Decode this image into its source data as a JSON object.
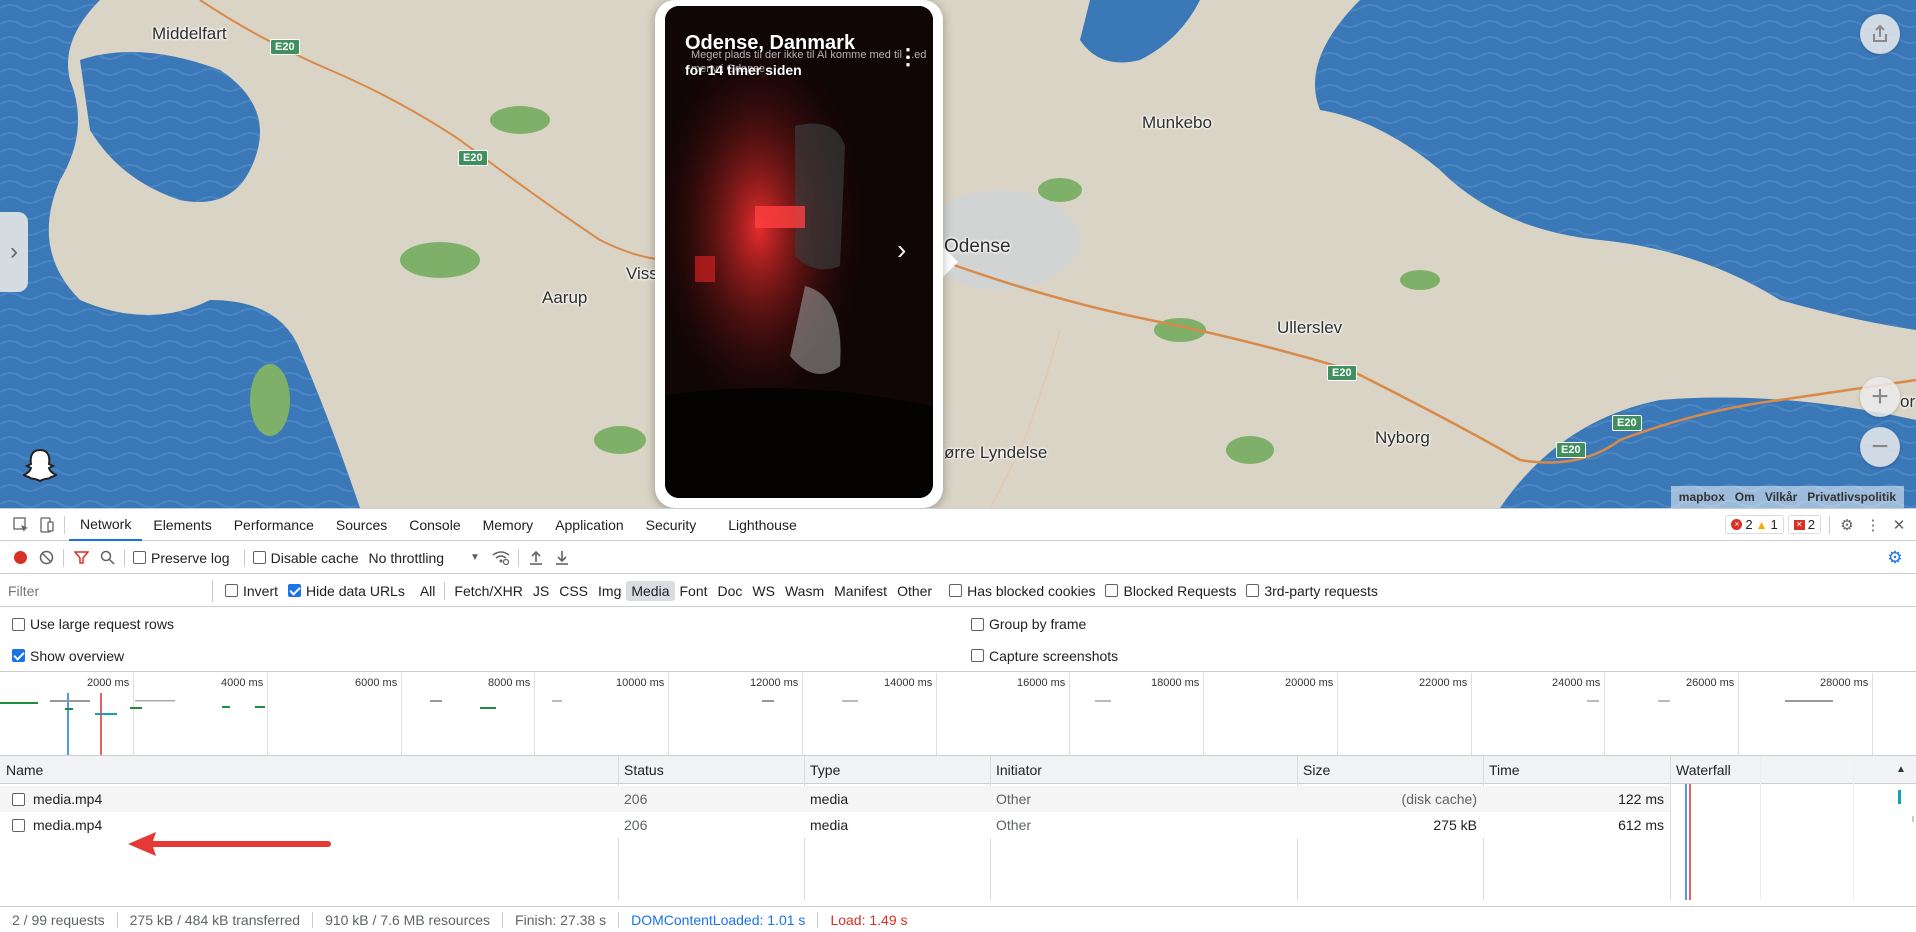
{
  "map": {
    "towns": [
      {
        "name": "Middelfart"
      },
      {
        "name": "Munkebo"
      },
      {
        "name": "Odense"
      },
      {
        "name": "Aarup"
      },
      {
        "name": "Viss"
      },
      {
        "name": "Ullerslev"
      },
      {
        "name": "Nyborg"
      },
      {
        "name": "ørre Lyndelse"
      },
      {
        "name": "or"
      }
    ],
    "road_label": "E20",
    "zoom_in": "+",
    "zoom_out": "−",
    "attribution": {
      "logo": "mapbox",
      "about": "Om",
      "terms": "Vilkår",
      "privacy": "Privatlivspolitik"
    },
    "colors": {
      "water": "#3a78b8",
      "land": "#d9d4c5",
      "park": "#7fb069",
      "road": "#d98a4a"
    }
  },
  "story": {
    "title": "Odense, Danmark",
    "time": "for 14 timer siden",
    "caption": "Meget plads til der ikke til AI komme med til ...ed meny i Odense",
    "menu_icon": "vertical-dots-icon"
  },
  "devtools": {
    "tabs": [
      "Network",
      "Elements",
      "Performance",
      "Sources",
      "Console",
      "Memory",
      "Application",
      "Security",
      "Lighthouse"
    ],
    "active_tab": "Network",
    "badges": {
      "errors": "2",
      "warnings": "1",
      "issues": "2"
    },
    "toolbar": {
      "preserve_log": "Preserve log",
      "disable_cache": "Disable cache",
      "throttling": "No throttling"
    },
    "filter": {
      "placeholder": "Filter",
      "invert": "Invert",
      "hide_data_urls": "Hide data URLs",
      "types": [
        "All",
        "Fetch/XHR",
        "JS",
        "CSS",
        "Img",
        "Media",
        "Font",
        "Doc",
        "WS",
        "Wasm",
        "Manifest",
        "Other"
      ],
      "active_type": "Media",
      "has_blocked_cookies": "Has blocked cookies",
      "blocked_requests": "Blocked Requests",
      "third_party": "3rd-party requests"
    },
    "options": {
      "large_rows": "Use large request rows",
      "group_by_frame": "Group by frame",
      "show_overview": "Show overview",
      "capture_screenshots": "Capture screenshots"
    },
    "overview_ticks": [
      "2000 ms",
      "4000 ms",
      "6000 ms",
      "8000 ms",
      "10000 ms",
      "12000 ms",
      "14000 ms",
      "16000 ms",
      "18000 ms",
      "20000 ms",
      "22000 ms",
      "24000 ms",
      "26000 ms",
      "28000 ms"
    ],
    "columns": [
      "Name",
      "Status",
      "Type",
      "Initiator",
      "Size",
      "Time",
      "Waterfall"
    ],
    "rows": [
      {
        "name": "media.mp4",
        "status": "206",
        "type": "media",
        "initiator": "Other",
        "size": "(disk cache)",
        "time": "122 ms"
      },
      {
        "name": "media.mp4",
        "status": "206",
        "type": "media",
        "initiator": "Other",
        "size": "275 kB",
        "time": "612 ms"
      }
    ],
    "status": {
      "requests": "2 / 99 requests",
      "transferred": "275 kB / 484 kB transferred",
      "resources": "910 kB / 7.6 MB resources",
      "finish": "Finish: 27.38 s",
      "dcl": "DOMContentLoaded: 1.01 s",
      "load": "Load: 1.49 s"
    }
  }
}
